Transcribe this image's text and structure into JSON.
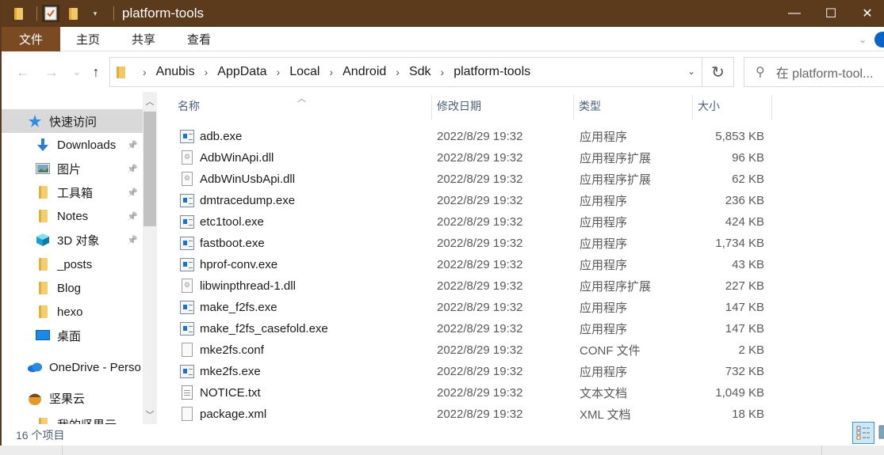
{
  "window": {
    "title": "platform-tools",
    "controls": {
      "minimize": "—",
      "maximize": "☐",
      "close": "✕"
    }
  },
  "quick_access_toolbar": {
    "icons": [
      "folder-icon",
      "properties-icon",
      "new-folder-icon",
      "customize-dropdown-icon"
    ]
  },
  "ribbon": {
    "tabs": [
      {
        "label": "文件",
        "active": true
      },
      {
        "label": "主页"
      },
      {
        "label": "共享"
      },
      {
        "label": "查看"
      }
    ]
  },
  "navigation": {
    "back": "←",
    "forward": "→",
    "recent": "⌄",
    "up": "↑",
    "breadcrumb": [
      "Anubis",
      "AppData",
      "Local",
      "Android",
      "Sdk",
      "platform-tools"
    ],
    "search_placeholder": "在 platform-tool..."
  },
  "nav_pane": {
    "items": [
      {
        "label": "快速访问",
        "icon": "star-icon",
        "selected": true,
        "level": 0
      },
      {
        "label": "Downloads",
        "icon": "download-icon",
        "pinned": true,
        "level": 1
      },
      {
        "label": "图片",
        "icon": "pictures-icon",
        "pinned": true,
        "level": 1
      },
      {
        "label": "工具箱",
        "icon": "folder-icon",
        "pinned": true,
        "level": 1
      },
      {
        "label": "Notes",
        "icon": "folder-icon",
        "pinned": true,
        "level": 1
      },
      {
        "label": "3D 对象",
        "icon": "3d-objects-icon",
        "pinned": true,
        "level": 1
      },
      {
        "label": "_posts",
        "icon": "folder-icon",
        "level": 1
      },
      {
        "label": "Blog",
        "icon": "folder-icon",
        "level": 1
      },
      {
        "label": "hexo",
        "icon": "folder-icon",
        "level": 1
      },
      {
        "label": "桌面",
        "icon": "desktop-icon",
        "level": 1
      },
      {
        "label": "OneDrive - Perso",
        "icon": "onedrive-icon",
        "level": 0
      },
      {
        "label": "坚果云",
        "icon": "nutstore-icon",
        "level": 0
      },
      {
        "label": "我的坚果云",
        "icon": "folder-icon",
        "level": 1
      }
    ]
  },
  "file_list": {
    "columns": {
      "name": "名称",
      "date": "修改日期",
      "type": "类型",
      "size": "大小"
    },
    "rows": [
      {
        "name": "adb.exe",
        "date": "2022/8/29 19:32",
        "type": "应用程序",
        "size": "5,853 KB",
        "icon": "exe"
      },
      {
        "name": "AdbWinApi.dll",
        "date": "2022/8/29 19:32",
        "type": "应用程序扩展",
        "size": "96 KB",
        "icon": "dll"
      },
      {
        "name": "AdbWinUsbApi.dll",
        "date": "2022/8/29 19:32",
        "type": "应用程序扩展",
        "size": "62 KB",
        "icon": "dll"
      },
      {
        "name": "dmtracedump.exe",
        "date": "2022/8/29 19:32",
        "type": "应用程序",
        "size": "236 KB",
        "icon": "exe"
      },
      {
        "name": "etc1tool.exe",
        "date": "2022/8/29 19:32",
        "type": "应用程序",
        "size": "424 KB",
        "icon": "exe"
      },
      {
        "name": "fastboot.exe",
        "date": "2022/8/29 19:32",
        "type": "应用程序",
        "size": "1,734 KB",
        "icon": "exe"
      },
      {
        "name": "hprof-conv.exe",
        "date": "2022/8/29 19:32",
        "type": "应用程序",
        "size": "43 KB",
        "icon": "exe"
      },
      {
        "name": "libwinpthread-1.dll",
        "date": "2022/8/29 19:32",
        "type": "应用程序扩展",
        "size": "227 KB",
        "icon": "dll"
      },
      {
        "name": "make_f2fs.exe",
        "date": "2022/8/29 19:32",
        "type": "应用程序",
        "size": "147 KB",
        "icon": "exe"
      },
      {
        "name": "make_f2fs_casefold.exe",
        "date": "2022/8/29 19:32",
        "type": "应用程序",
        "size": "147 KB",
        "icon": "exe"
      },
      {
        "name": "mke2fs.conf",
        "date": "2022/8/29 19:32",
        "type": "CONF 文件",
        "size": "2 KB",
        "icon": "doc"
      },
      {
        "name": "mke2fs.exe",
        "date": "2022/8/29 19:32",
        "type": "应用程序",
        "size": "732 KB",
        "icon": "exe"
      },
      {
        "name": "NOTICE.txt",
        "date": "2022/8/29 19:32",
        "type": "文本文档",
        "size": "1,049 KB",
        "icon": "txt"
      },
      {
        "name": "package.xml",
        "date": "2022/8/29 19:32",
        "type": "XML 文档",
        "size": "18 KB",
        "icon": "doc"
      }
    ]
  },
  "status_bar": {
    "item_count": "16 个项目"
  }
}
